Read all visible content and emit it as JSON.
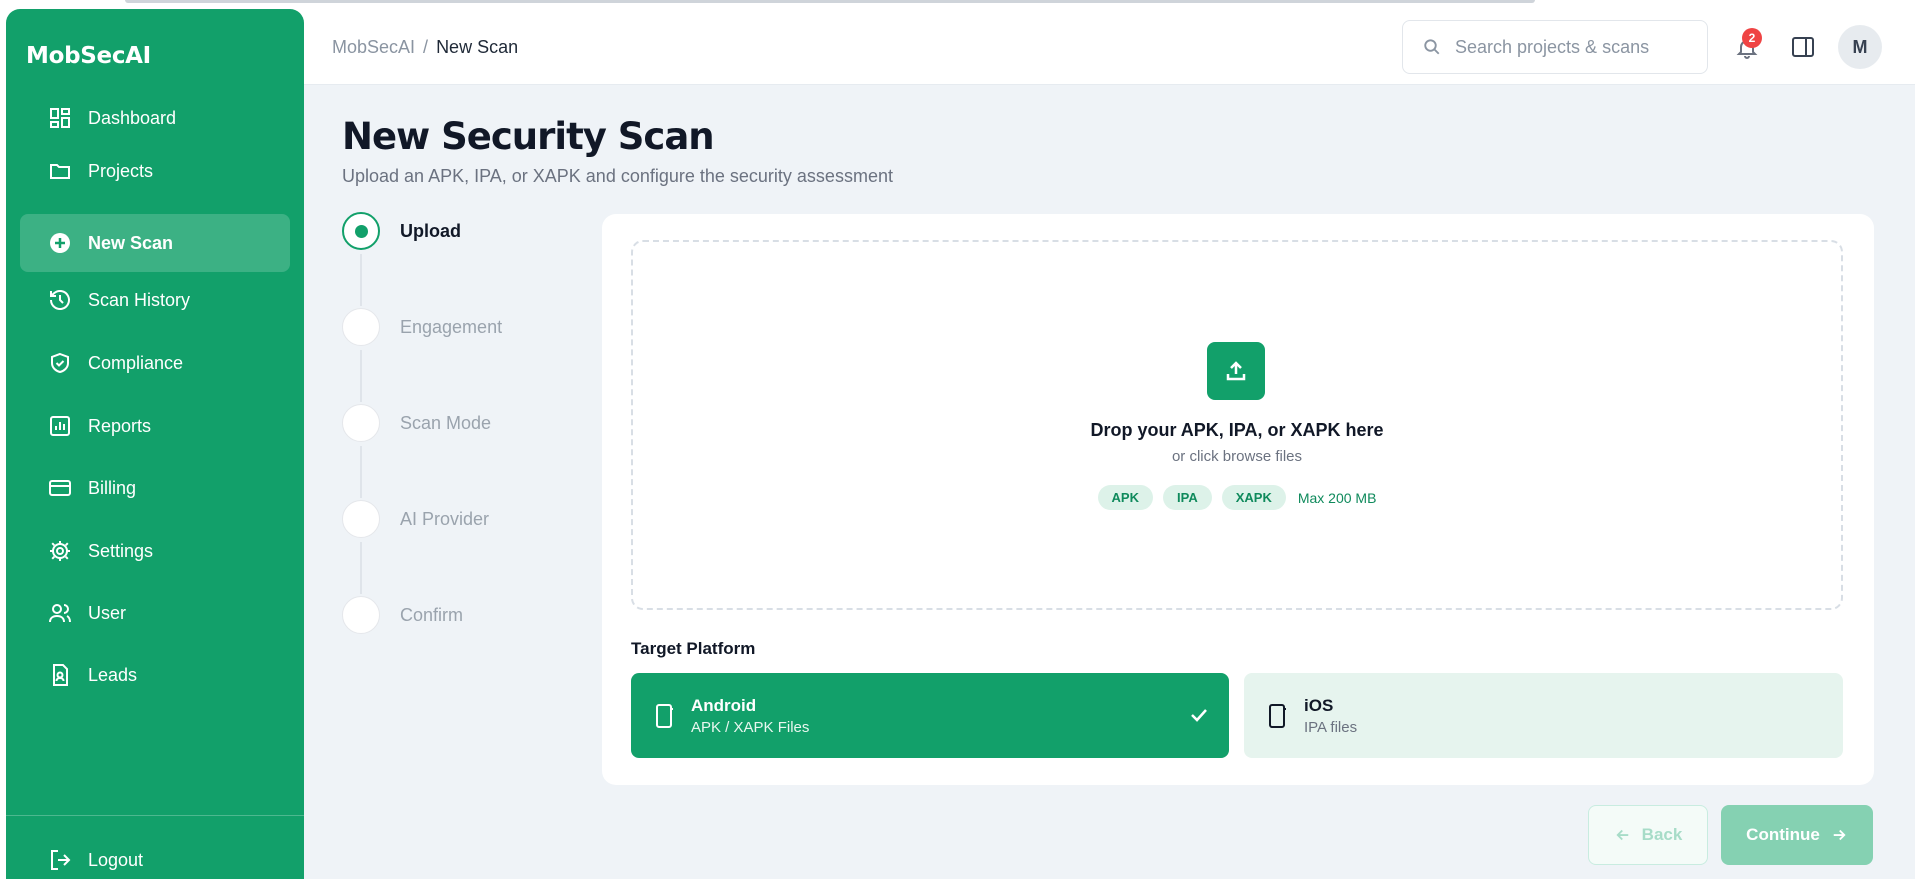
{
  "app": {
    "name": "MobSecAI"
  },
  "sidebar": {
    "items": [
      {
        "label": "Dashboard",
        "icon": "dashboard-icon"
      },
      {
        "label": "Projects",
        "icon": "folder-icon"
      },
      {
        "label": "New Scan",
        "icon": "plus-circle-icon",
        "active": true
      },
      {
        "label": "Scan History",
        "icon": "history-icon"
      },
      {
        "label": "Compliance",
        "icon": "shield-check-icon"
      },
      {
        "label": "Reports",
        "icon": "bar-chart-icon"
      },
      {
        "label": "Billing",
        "icon": "credit-card-icon"
      },
      {
        "label": "Settings",
        "icon": "gear-icon"
      },
      {
        "label": "User",
        "icon": "users-icon"
      },
      {
        "label": "Leads",
        "icon": "contact-file-icon"
      }
    ],
    "logout": "Logout"
  },
  "header": {
    "breadcrumb": {
      "root": "MobSecAI",
      "separator": "/",
      "current": "New Scan"
    },
    "search_placeholder": "Search projects & scans",
    "notification_count": "2",
    "avatar_initial": "M"
  },
  "page": {
    "title": "New Security Scan",
    "subtitle": "Upload an APK, IPA, or XAPK and configure the security assessment"
  },
  "steps": [
    {
      "label": "Upload",
      "active": true
    },
    {
      "label": "Engagement"
    },
    {
      "label": "Scan Mode"
    },
    {
      "label": "AI Provider"
    },
    {
      "label": "Confirm"
    }
  ],
  "dropzone": {
    "title": "Drop your APK, IPA, or XAPK here",
    "subtitle": "or click browse files",
    "tags": [
      "APK",
      "IPA",
      "XAPK"
    ],
    "max_size": "Max 200 MB"
  },
  "platform": {
    "label": "Target Platform",
    "options": [
      {
        "name": "Android",
        "desc": "APK / XAPK Files",
        "selected": true
      },
      {
        "name": "iOS",
        "desc": "IPA files",
        "selected": false
      }
    ]
  },
  "actions": {
    "back": "Back",
    "continue": "Continue"
  },
  "colors": {
    "brand": "#12a06a",
    "page_bg": "#eff3f7",
    "badge": "#ef4444"
  }
}
